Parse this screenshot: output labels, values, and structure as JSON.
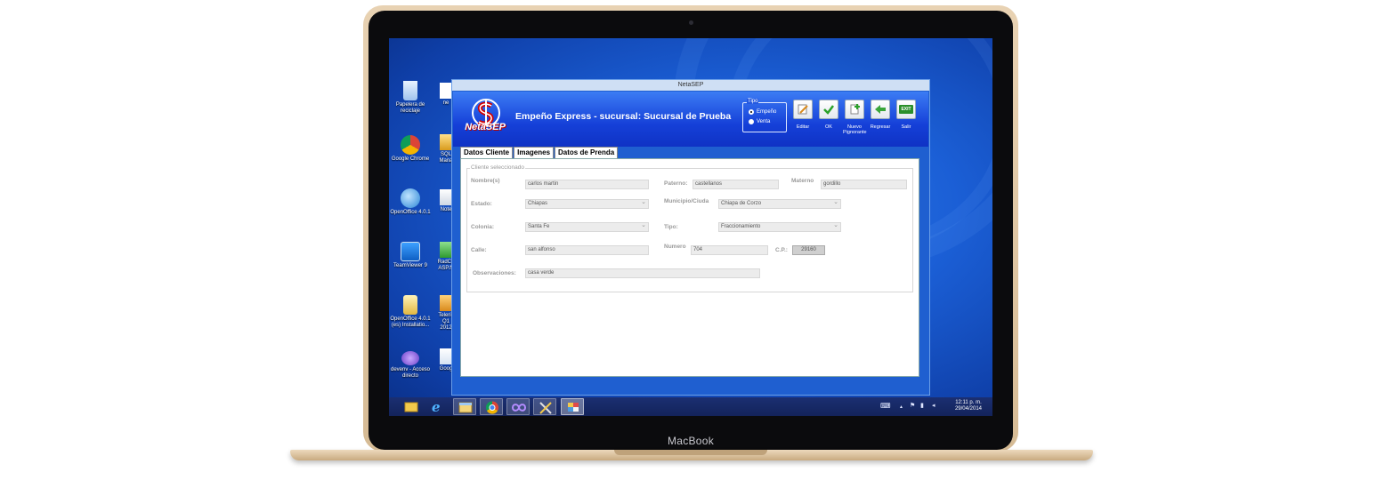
{
  "device": {
    "brand": "MacBook"
  },
  "desktop": {
    "icons_left": [
      {
        "name": "recycle-bin-icon",
        "label": "Papelera de reciclaje"
      },
      {
        "name": "chrome-icon",
        "label": "Google Chrome"
      },
      {
        "name": "openoffice-icon",
        "label": "OpenOffice 4.0.1"
      },
      {
        "name": "teamviewer-icon",
        "label": "TeamViewer 9"
      },
      {
        "name": "folder-installer-icon",
        "label": "OpenOffice 4.0.1 (es) Installatio..."
      },
      {
        "name": "devenv-icon",
        "label": "devenv - Acceso directo"
      }
    ],
    "icons_right": [
      {
        "name": "file-icon",
        "label": "ne"
      },
      {
        "name": "sql-icon",
        "label": "SQL Mana"
      },
      {
        "name": "notepad-icon",
        "label": "Note"
      },
      {
        "name": "radcontrols-icon",
        "label": "RadCo ASP.N"
      },
      {
        "name": "telerik-icon",
        "label": "Telerik Q1 2012"
      },
      {
        "name": "google-icon",
        "label": "Goog"
      }
    ]
  },
  "window": {
    "title": "NetaSEP",
    "logo_text": "NetaSEP",
    "app_title": "Empeño Express - sucursal: Sucursal de Prueba",
    "tipo": {
      "legend": "Tipo",
      "options": [
        {
          "label": "Empeño",
          "selected": true
        },
        {
          "label": "Venta",
          "selected": false
        }
      ]
    },
    "toolbar": {
      "editar": "Editar",
      "ok": "OK",
      "nuevo": "Nuevo Pignorante",
      "regresar": "Regresar",
      "salir": "Salir",
      "exit_badge": "EXIT"
    },
    "tabs": [
      "Datos Cliente",
      "Imagenes",
      "Datos de Prenda"
    ],
    "form": {
      "group_legend": "Cliente seleccionado",
      "nombre_label": "Nombre(s)",
      "nombre": "carlos martin",
      "paterno_label": "Paterno:",
      "paterno": "castellanos",
      "materno_label": "Materno",
      "materno": "gordillo",
      "estado_label": "Estado:",
      "estado": "Chiapas",
      "municipio_label": "Municipio/Ciuda",
      "municipio": "Chiapa de Corzo",
      "colonia_label": "Colonia:",
      "colonia": "Santa Fe",
      "tipo_label": "Tipo:",
      "tipo": "Fraccionamiento",
      "calle_label": "Calle:",
      "calle": "san alfonso",
      "numero_label": "Numero",
      "numero": "704",
      "cp_label": "C.P.:",
      "cp": "29160",
      "obs_label": "Observaciones:",
      "obs": "casa verde"
    }
  },
  "taskbar": {
    "clock_time": "12:11 p. m.",
    "clock_date": "29/04/2014",
    "tray_chevron": "▲"
  },
  "colors": {
    "desktop": "#1b5fd6",
    "header": "#1540d8",
    "taskbar": "#13235a",
    "frame": "#d6bb95"
  }
}
